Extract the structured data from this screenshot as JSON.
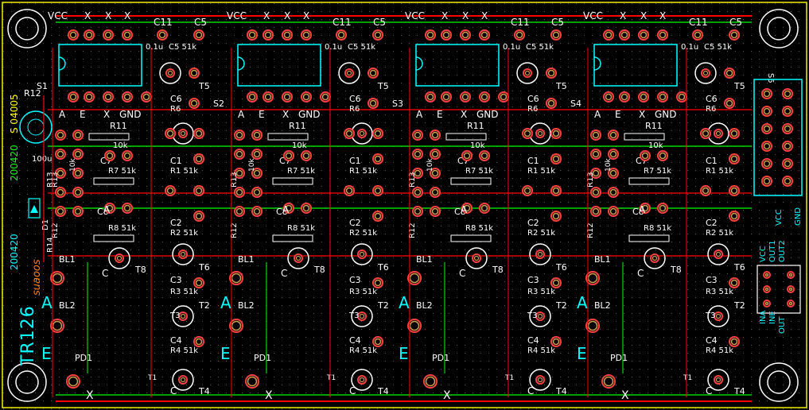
{
  "board": {
    "name": "TR126",
    "date_code": "200420",
    "date_code_green": "200420",
    "revision": "S 04005",
    "brand": "suaoos",
    "grid_dots": true
  },
  "colors": {
    "background": "#000000",
    "silkscreen": "#00FFFF",
    "silkscreen_white": "#FFFFFF",
    "top_trace": "#FF0000",
    "bottom_trace": "#00FF00",
    "pad_fill": "#C8A050",
    "pad_outline": "#FF4040",
    "via": "#FFFFFF",
    "label_white": "#FFFFFF",
    "magenta": "#FF00FF",
    "yellow": "#FFFF00",
    "green_label": "#00FF00",
    "orange_label": "#FF8000",
    "blue_label": "#3050FF"
  },
  "channel": {
    "header_labels": [
      "VCC",
      "X",
      "X",
      "X"
    ],
    "c11": "C11",
    "c5": "C5",
    "cap_val_1": "0.1u",
    "c5_val": "C5 51k",
    "t5": "T5",
    "c6": "C6",
    "r6": "R6",
    "bus_labels": [
      "A",
      "E",
      "X",
      "GND"
    ],
    "r11": "R11",
    "r11_val": "10k",
    "c7": "C7",
    "r7": "R7 51k",
    "r13": "R13",
    "r13_val": "10k",
    "r12": "R12",
    "c1": "C1",
    "r1": "R1 51k",
    "c8": "C8",
    "r8": "R8 51k",
    "t8": "T8",
    "c2": "C2",
    "r2": "R2 51k",
    "t6": "T6",
    "bl1": "BL1",
    "bl2": "BL2",
    "c3": "C3",
    "r3": "R3 51k",
    "t2": "T2",
    "t3": "T3",
    "c4": "C4",
    "r4": "R4 51k",
    "pd1": "PD1",
    "t1": "T1",
    "t4": "T4",
    "letter_a": "A",
    "letter_e": "E",
    "letter_c": "C",
    "x_mark": "X",
    "s_labels": [
      "S2",
      "S3",
      "S4"
    ]
  },
  "left_strip": {
    "r12": "R12",
    "s1": "S1",
    "c100u": "100u",
    "d1": "D1",
    "r14": "R14",
    "r13": "R13"
  },
  "connector": {
    "s5": "S5",
    "top_labels": [
      "VCC",
      "GND"
    ],
    "mid_labels": [
      "VCC",
      "OUT1",
      "OUT2"
    ],
    "bottom_labels": [
      "INA",
      "INE",
      "OUT"
    ]
  }
}
